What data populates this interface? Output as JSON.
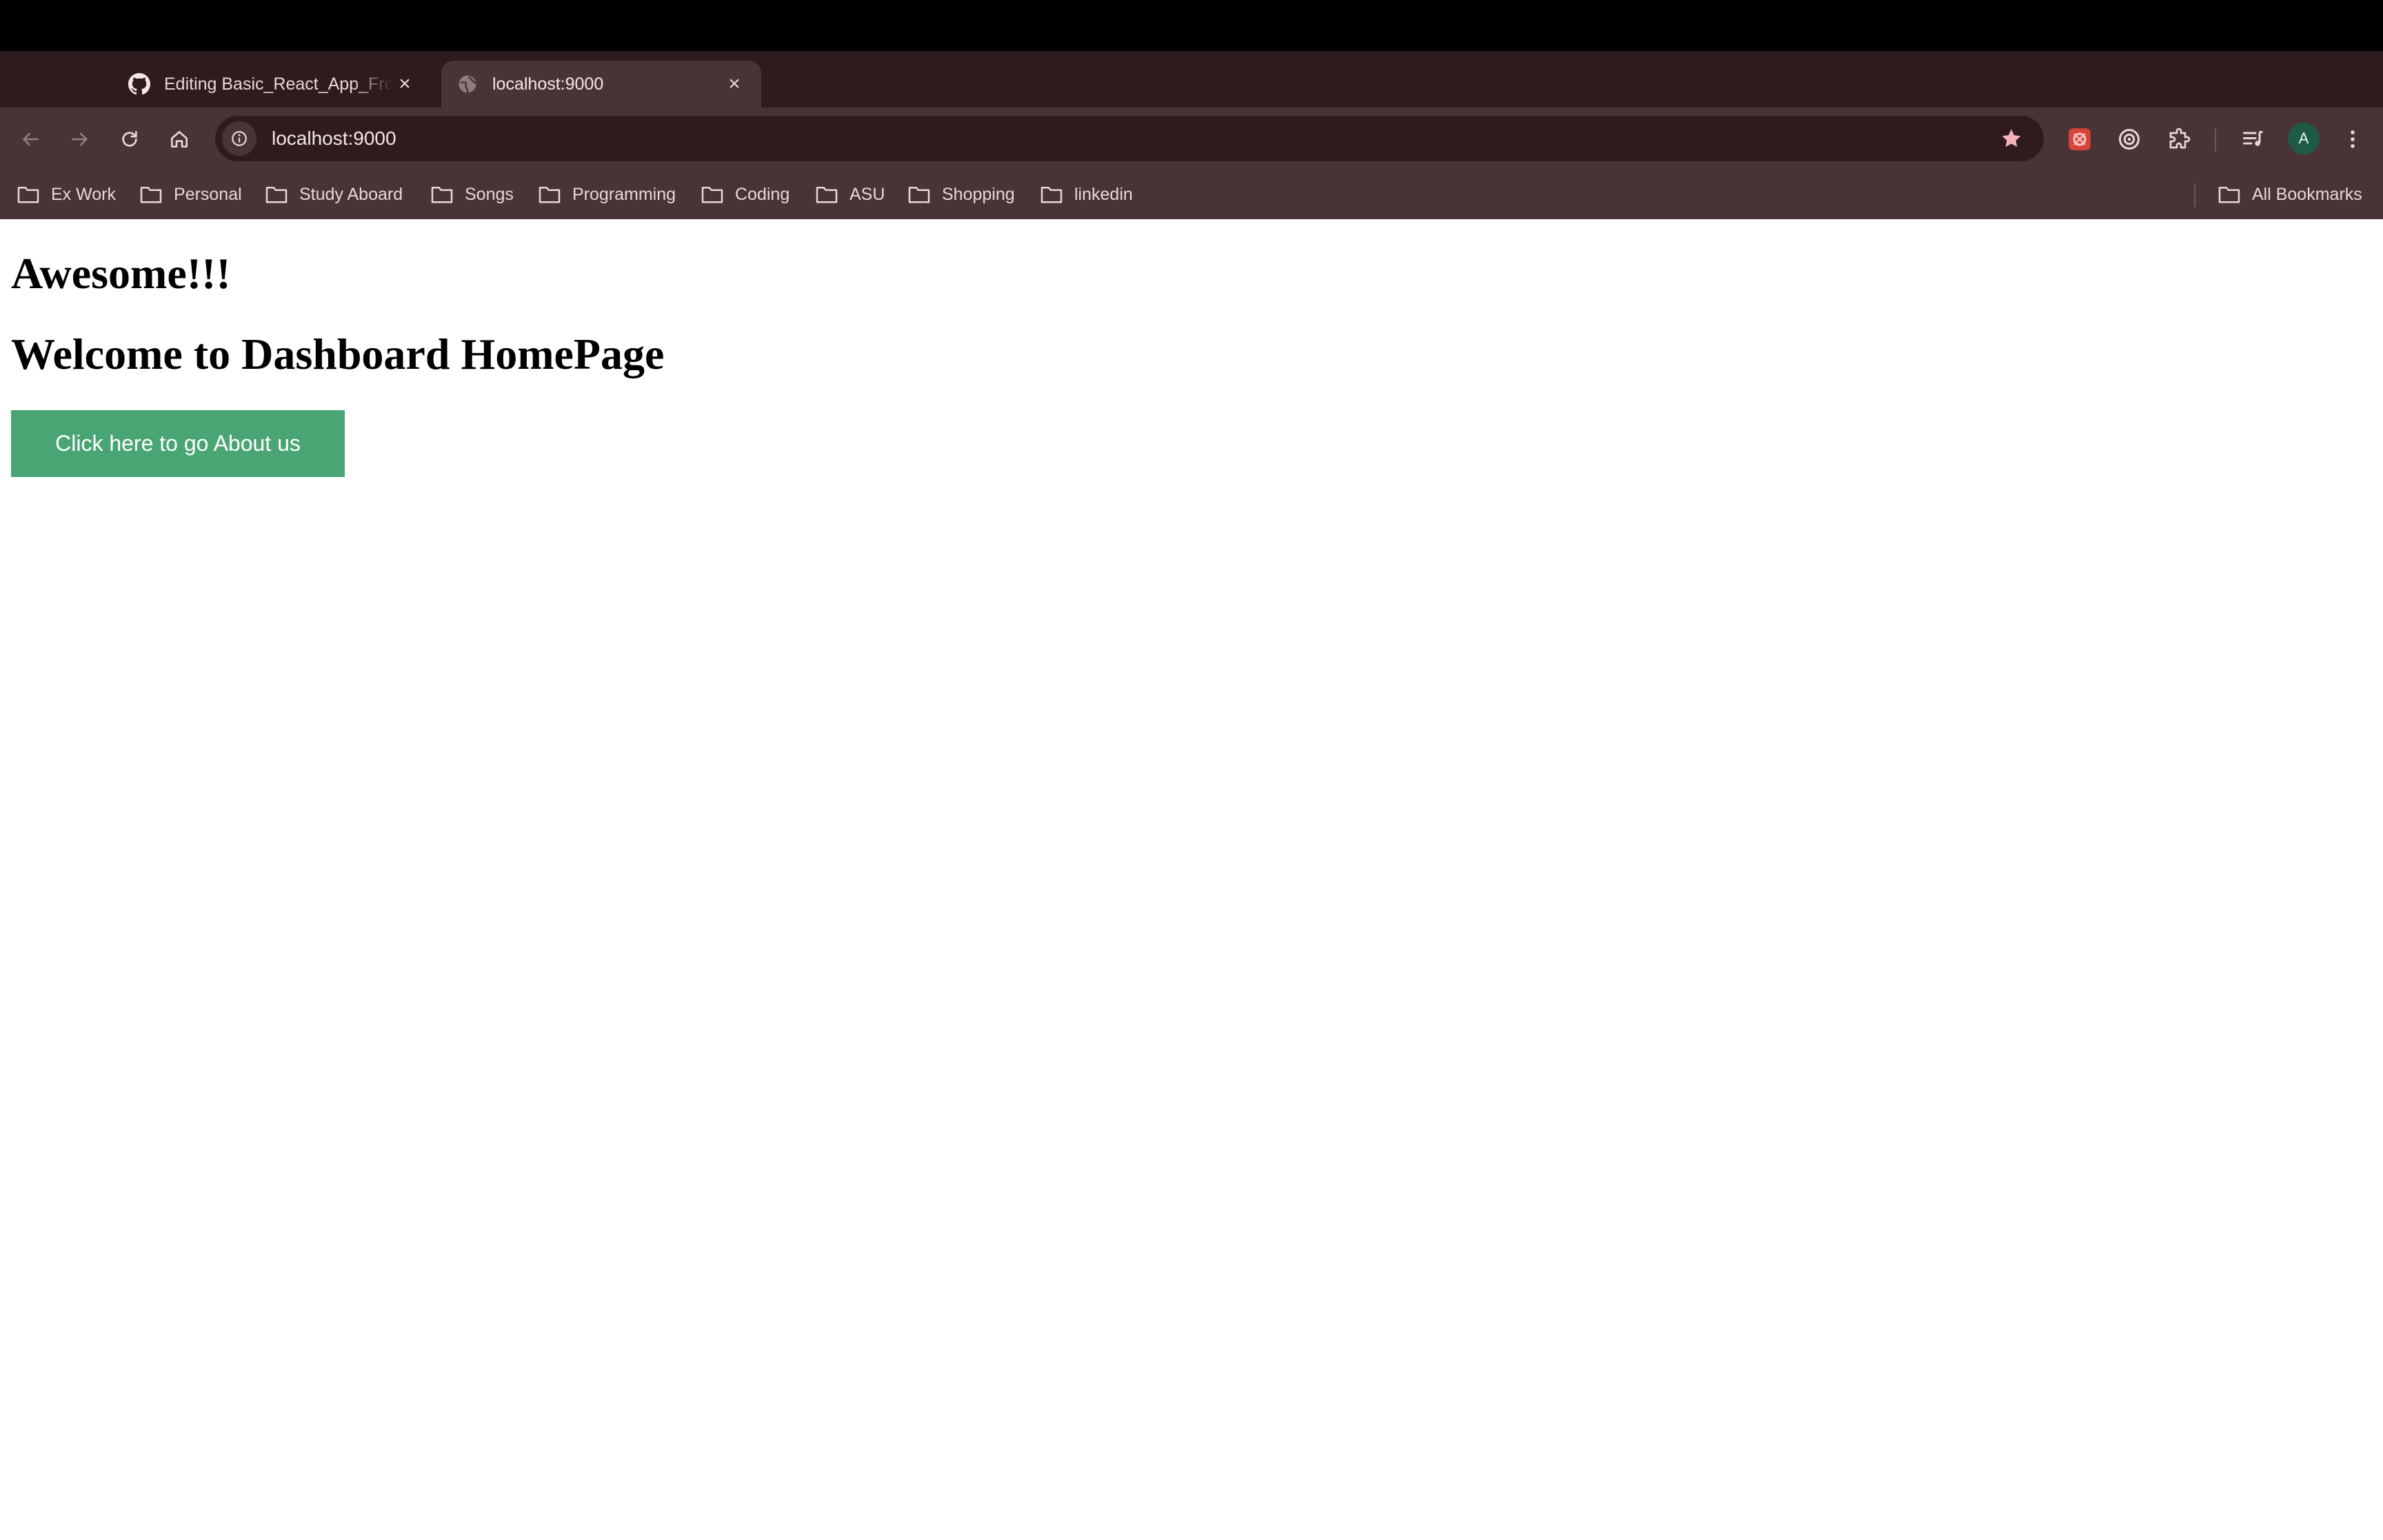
{
  "browser": {
    "tabs": [
      {
        "title": "Editing Basic_React_App_Fro",
        "favicon": "github-icon",
        "active": false
      },
      {
        "title": "localhost:9000",
        "favicon": "globe-icon",
        "active": true
      }
    ],
    "new_tab_label": "+",
    "address_bar": {
      "url": "localhost:9000"
    },
    "profile_initial": "A",
    "bookmarks": [
      {
        "label": "Ex Work"
      },
      {
        "label": "Personal"
      },
      {
        "label": "Study Aboard"
      },
      {
        "label": "Songs"
      },
      {
        "label": "Programming"
      },
      {
        "label": "Coding"
      },
      {
        "label": "ASU"
      },
      {
        "label": "Shopping"
      },
      {
        "label": "linkedin"
      }
    ],
    "all_bookmarks_label": "All Bookmarks",
    "theme_colors": {
      "frame": "#2e1b1d",
      "toolbar": "#4a3336",
      "text": "#ead6d7"
    }
  },
  "page": {
    "heading_1": "Awesome!!!",
    "heading_2": "Welcome to Dashboard HomePage",
    "about_button_label": "Click here to go About us",
    "button_color": "#4aa574"
  }
}
